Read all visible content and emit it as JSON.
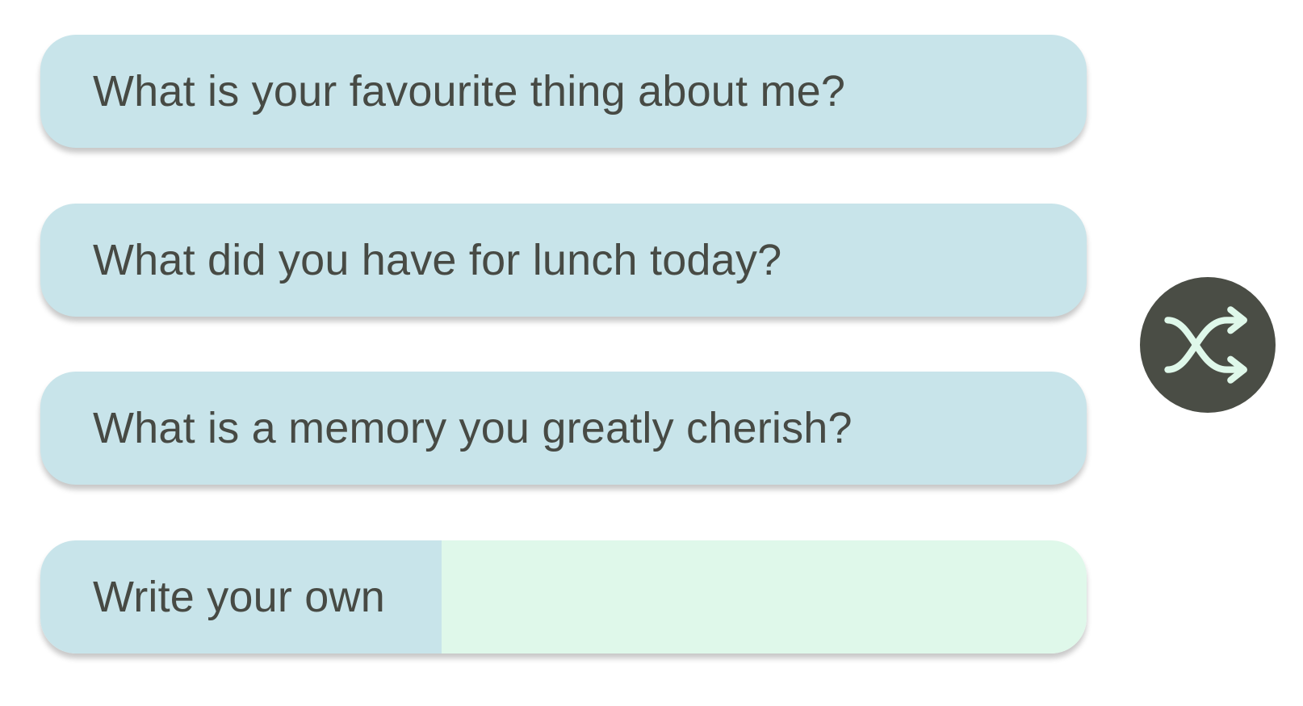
{
  "prompts": [
    {
      "label": "What is your favourite thing about me?"
    },
    {
      "label": "What did you have for lunch today?"
    },
    {
      "label": "What is a memory you greatly cherish?"
    }
  ],
  "write_own": {
    "label": "Write your own",
    "value": "",
    "placeholder": ""
  },
  "shuffle": {
    "icon": "shuffle-icon"
  },
  "colors": {
    "prompt_bg": "#c8e4ea",
    "input_bg": "#dff8ea",
    "text": "#474a44",
    "button_bg": "#4a4d45",
    "icon": "#dff8ea"
  }
}
